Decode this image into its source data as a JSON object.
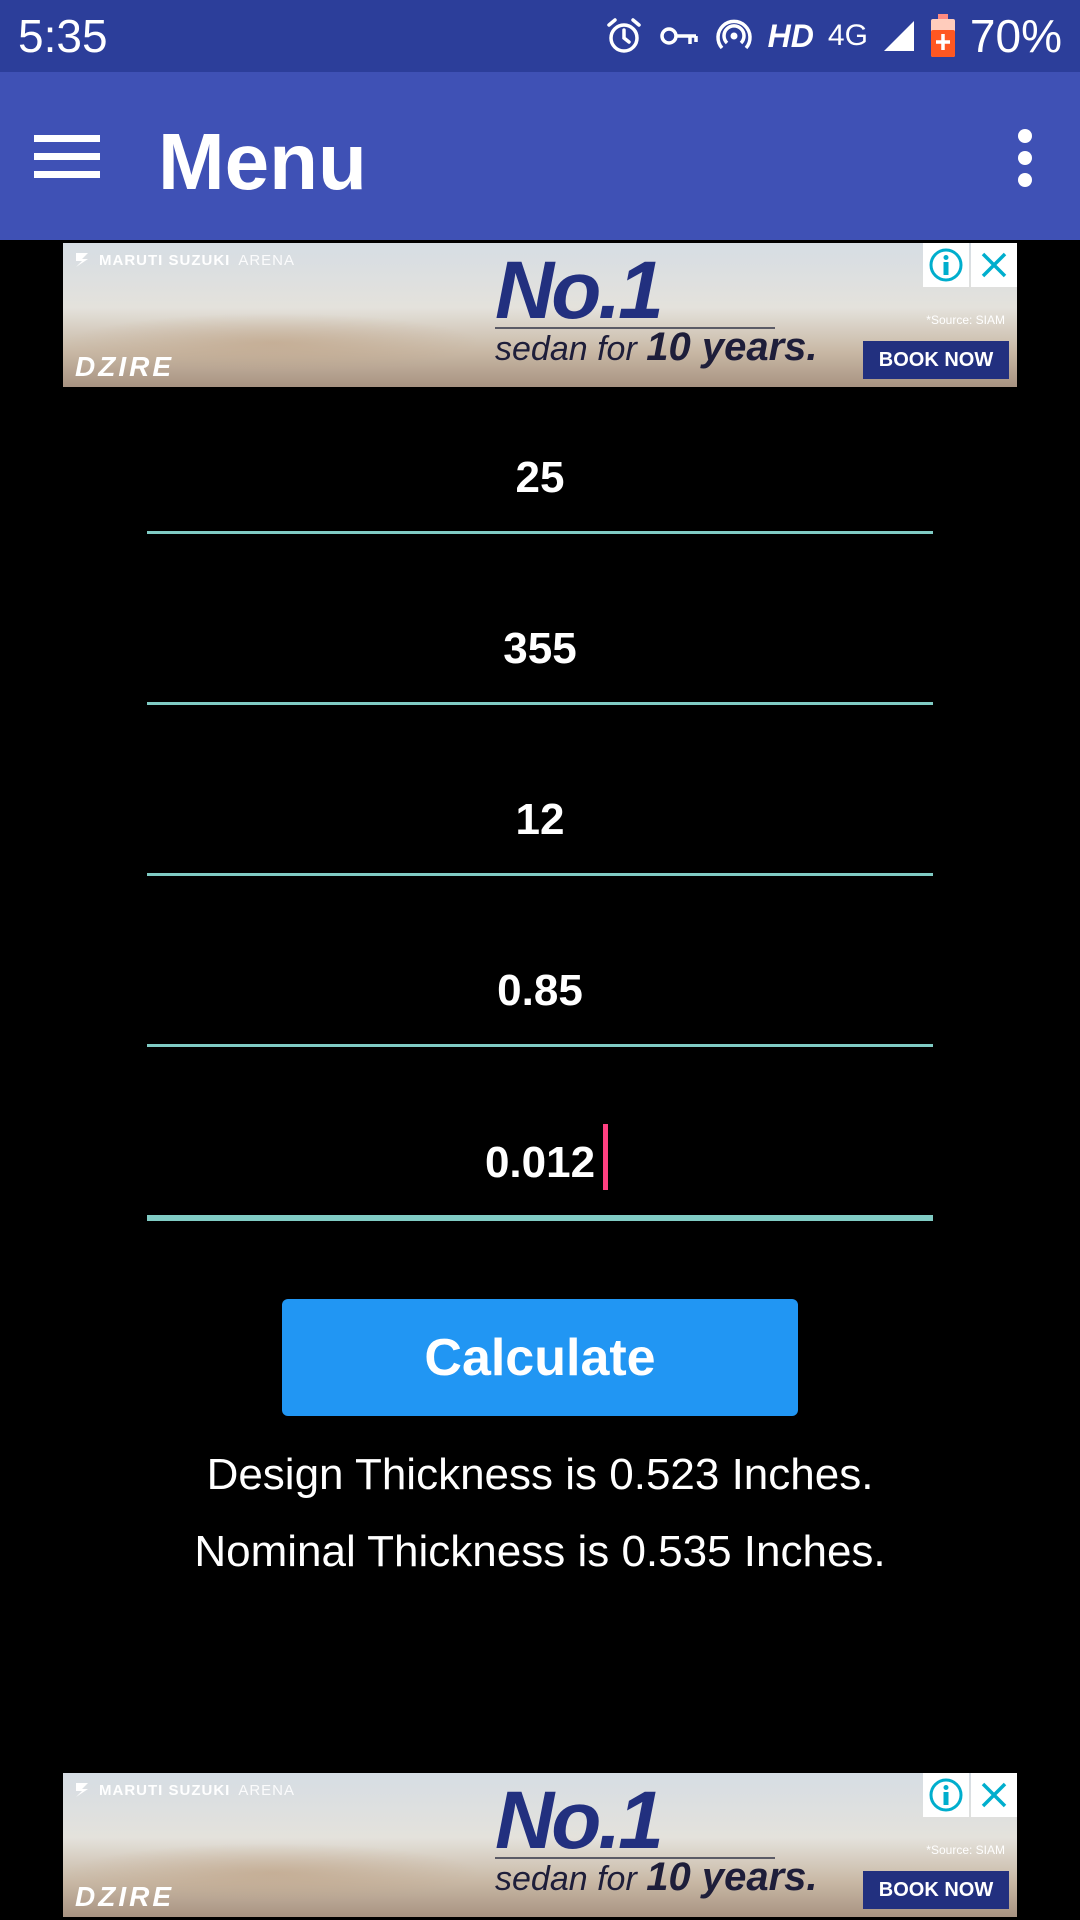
{
  "status_bar": {
    "time": "5:35",
    "hd_label": "HD",
    "network_label": "4G",
    "battery_percent": "70%",
    "icons": [
      "alarm-icon",
      "vpn-key-icon",
      "hotspot-icon",
      "signal-icon",
      "battery-icon"
    ]
  },
  "app_bar": {
    "title": "Menu",
    "background": "#3f51b5",
    "icons": [
      "hamburger-menu-icon",
      "overflow-menu-icon"
    ]
  },
  "ad": {
    "brand": "MARUTI SUZUKI",
    "brand_sub": "ARENA",
    "headline": "No.1",
    "tagline_prefix": "sedan for ",
    "tagline_emphasis": "10 years.",
    "source": "*Source: SIAM",
    "cta": "BOOK NOW",
    "logo": "DZIRE",
    "icons": [
      "ad-info-icon",
      "ad-close-icon"
    ]
  },
  "form": {
    "inputs": [
      {
        "value": "25"
      },
      {
        "value": "355"
      },
      {
        "value": "12"
      },
      {
        "value": "0.85"
      },
      {
        "value": "0.012"
      }
    ],
    "underline_color": "#80cbc4",
    "caret_color": "#ff4081"
  },
  "actions": {
    "calculate_label": "Calculate",
    "button_color": "#2196f3"
  },
  "results": {
    "design_thickness": "Design Thickness is 0.523 Inches.",
    "nominal_thickness": "Nominal Thickness is 0.535 Inches."
  }
}
